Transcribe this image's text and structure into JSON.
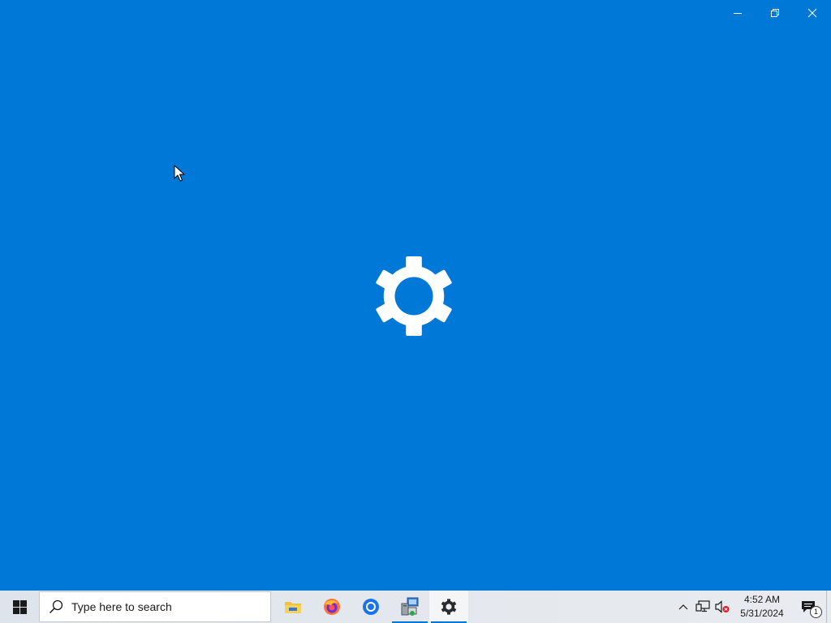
{
  "window": {
    "app_icon": "gear-icon",
    "controls": {
      "minimize": "minimize-icon",
      "restore": "restore-icon",
      "close": "close-icon"
    }
  },
  "taskbar": {
    "start_icon": "windows-logo-icon",
    "search": {
      "placeholder": "Type here to search",
      "icon": "search-icon"
    },
    "apps": [
      {
        "name": "File Explorer",
        "icon": "folder-icon",
        "running": false,
        "active": false
      },
      {
        "name": "Firefox",
        "icon": "firefox-icon",
        "running": false,
        "active": false
      },
      {
        "name": "Chrome",
        "icon": "chrome-icon",
        "running": false,
        "active": false
      },
      {
        "name": "Network Setup",
        "icon": "computer-network-icon",
        "running": true,
        "active": false
      },
      {
        "name": "Settings",
        "icon": "gear-icon",
        "running": true,
        "active": true
      }
    ],
    "tray": {
      "icons": [
        "chevron-up-icon",
        "network-icon",
        "volume-muted-icon"
      ],
      "time": "4:52 AM",
      "date": "5/31/2024",
      "notification_count": "1"
    }
  },
  "colors": {
    "accent": "#0078d7",
    "taskbar": "#e4e8ee"
  }
}
